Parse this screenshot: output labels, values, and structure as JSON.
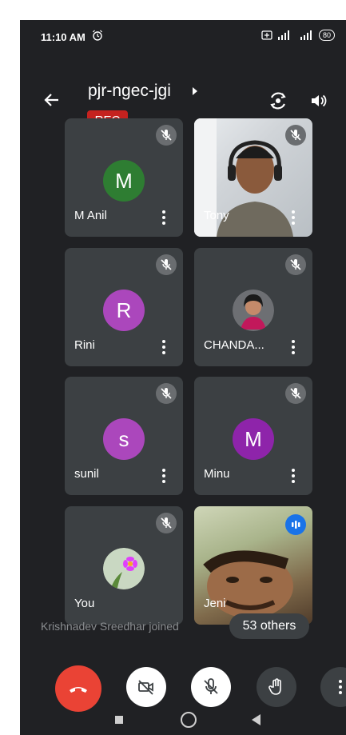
{
  "status_bar": {
    "time": "11:10 AM",
    "battery": "80"
  },
  "header": {
    "meeting_code": "pjr-ngec-jgi",
    "rec_label": "REC"
  },
  "participants": [
    {
      "name": "M Anil",
      "initial": "M",
      "avatar_color": "#2e7d32"
    },
    {
      "name": "Tony"
    },
    {
      "name": "Rini",
      "initial": "R",
      "avatar_color": "#ab47bc"
    },
    {
      "name": "CHANDA..."
    },
    {
      "name": "sunil",
      "initial": "s",
      "avatar_color": "#ab47bc"
    },
    {
      "name": "Minu",
      "initial": "M",
      "avatar_color": "#8e24aa"
    },
    {
      "name": "You"
    },
    {
      "name": "Jeni"
    }
  ],
  "toast": "Krishnadev Sreedhar joined",
  "others_pill": "53 others",
  "colors": {
    "background": "#202124",
    "tile": "#3c4043",
    "end_call": "#ea4335",
    "rec": "#c5221f",
    "accent": "#1a73e8"
  },
  "icons": {
    "back": "arrow-left-icon",
    "title_chevron": "caret-right-icon",
    "camera_switch": "camera-switch-icon",
    "speaker": "speaker-icon",
    "mic_off": "mic-off-icon",
    "end_call": "phone-hangup-icon",
    "cam_off": "video-off-icon",
    "raise_hand": "hand-icon",
    "more": "more-vert-icon"
  }
}
